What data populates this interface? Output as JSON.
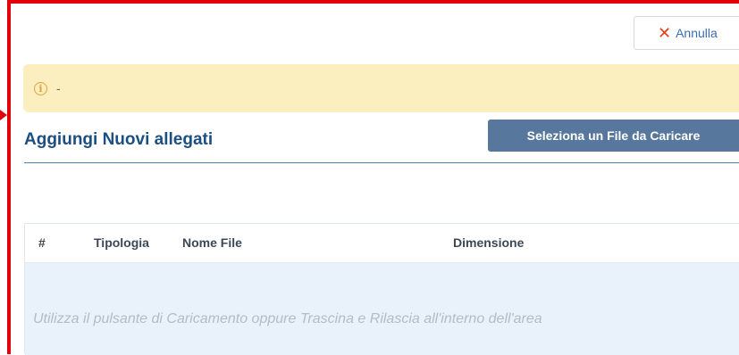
{
  "toolbar": {
    "cancel_label": "Annulla"
  },
  "alert": {
    "text": "-"
  },
  "section": {
    "title": "Aggiungi Nuovi allegati",
    "upload_button_label": "Seleziona un File da Caricare"
  },
  "table": {
    "columns": [
      "#",
      "Tipologia",
      "Nome File",
      "Dimensione"
    ],
    "empty_message": "Utilizza il pulsante di Caricamento oppure Trascina e Rilascia all'interno dell'area"
  },
  "colors": {
    "highlight_frame": "#e3000b",
    "title": "#1b4f82",
    "alert_bg": "#fcefbf",
    "primary_button": "#58779c",
    "dropzone_bg": "#e9f2fa"
  }
}
